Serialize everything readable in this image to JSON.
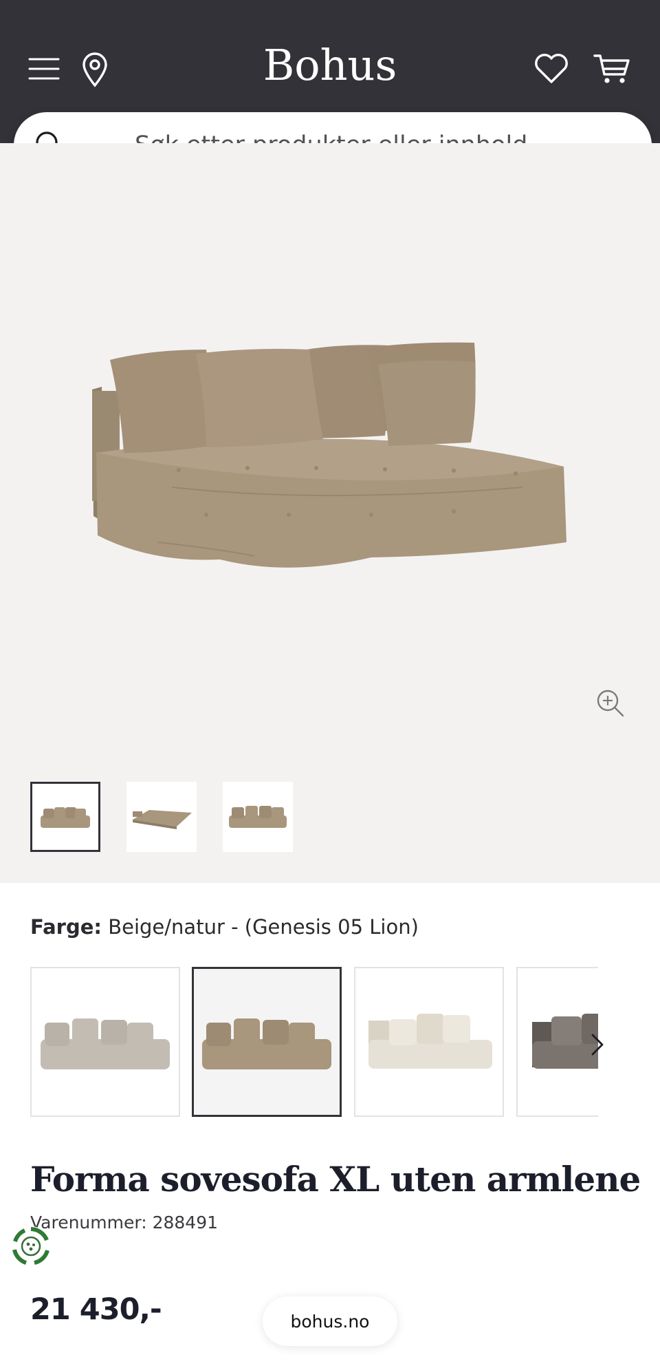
{
  "header": {
    "logo": "Bohus",
    "icons": [
      "menu-icon",
      "location-pin-icon",
      "heart-icon",
      "cart-icon"
    ]
  },
  "search": {
    "placeholder": "Søk etter produkter eller innhold ..."
  },
  "gallery": {
    "thumbnails": [
      "sofa-front",
      "sofa-bed-open",
      "sofa-front-alt"
    ],
    "active_thumbnail": 0
  },
  "color": {
    "label": "Farge:",
    "value": "Beige/natur - (Genesis 05 Lion)",
    "swatches": [
      {
        "name": "grey-beige",
        "color": "#c2bcb3"
      },
      {
        "name": "beige-natur",
        "color": "#a8967d"
      },
      {
        "name": "off-white",
        "color": "#e6e1d6"
      },
      {
        "name": "dark-grey",
        "color": "#7a736e"
      }
    ],
    "active_swatch": 1
  },
  "product": {
    "title": "Forma sovesofa XL uten armlene",
    "sku": "Varenummer: 288491",
    "price": "21 430,-"
  },
  "footer": {
    "url": "bohus.no"
  },
  "colors": {
    "header_bg": "#333238",
    "gallery_bg": "#f4f2f1",
    "sofa": "#a8967d",
    "text_dark": "#1c1f2b"
  }
}
